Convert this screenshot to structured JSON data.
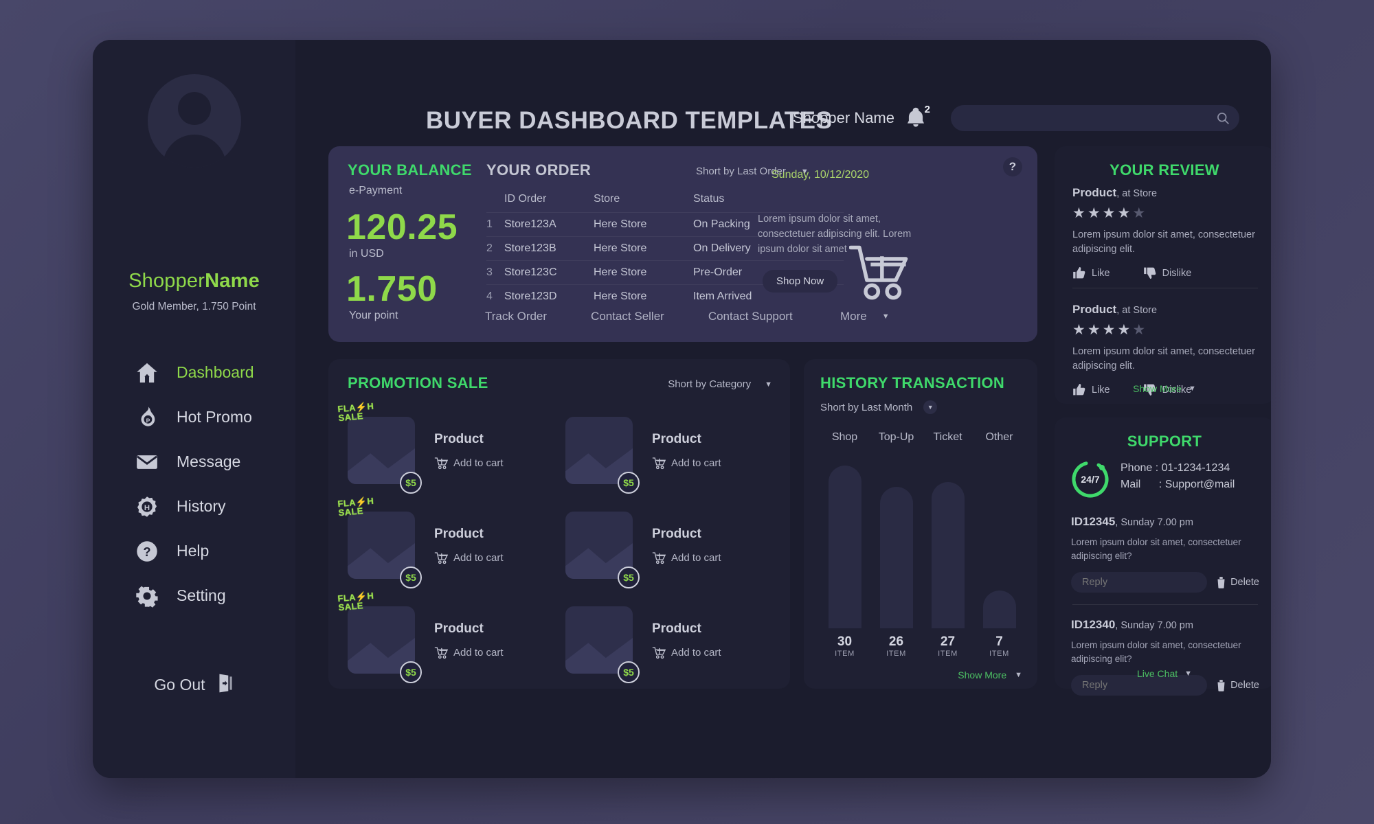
{
  "app": {
    "title": "BUYER DASHBOARD TEMPLATES"
  },
  "header": {
    "shopper_name": "Shopper Name",
    "notification_count": "2",
    "search_placeholder": ""
  },
  "sidebar": {
    "profile": {
      "name_light": "Shopper",
      "name_bold": "Name",
      "subtitle": "Gold Member, 1.750 Point"
    },
    "items": [
      {
        "label": "Dashboard",
        "icon": "home-icon",
        "active": true
      },
      {
        "label": "Hot Promo",
        "icon": "flame-icon",
        "active": false
      },
      {
        "label": "Message",
        "icon": "envelope-icon",
        "active": false
      },
      {
        "label": "History",
        "icon": "history-icon",
        "active": false
      },
      {
        "label": "Help",
        "icon": "question-icon",
        "active": false
      },
      {
        "label": "Setting",
        "icon": "gear-icon",
        "active": false
      }
    ],
    "logout_label": "Go Out"
  },
  "balance": {
    "title": "YOUR BALANCE",
    "epayment_label": "e-Payment",
    "amount": "120.25",
    "currency_label": "in USD",
    "points": "1.750",
    "points_label": "Your point"
  },
  "order": {
    "title": "YOUR ORDER",
    "sort_label": "Short by Last Order",
    "columns": [
      "",
      "ID Order",
      "Store",
      "Status"
    ],
    "rows": [
      {
        "n": "1",
        "id": "Store123A",
        "store": "Here Store",
        "status": "On Packing"
      },
      {
        "n": "2",
        "id": "Store123B",
        "store": "Here Store",
        "status": "On Delivery"
      },
      {
        "n": "3",
        "id": "Store123C",
        "store": "Here Store",
        "status": "Pre-Order"
      },
      {
        "n": "4",
        "id": "Store123D",
        "store": "Here Store",
        "status": "Item Arrived"
      }
    ],
    "links": [
      "Track Order",
      "Contact Seller",
      "Contact Support"
    ],
    "more_label": "More"
  },
  "promo_banner": {
    "help_label": "?",
    "date": "Sunday, 10/12/2020",
    "text": "Lorem ipsum dolor sit amet, consectetuer adipiscing elit. Lorem ipsum dolor sit  amet",
    "shop_now_label": "Shop Now"
  },
  "promotion": {
    "title": "PROMOTION SALE",
    "sort_label": "Short by Category",
    "items": [
      {
        "badge": "FLASH SALE",
        "name": "Product",
        "price": "$5",
        "cart_label": "Add to cart",
        "flash": true
      },
      {
        "badge": "",
        "name": "Product",
        "price": "$5",
        "cart_label": "Add to cart",
        "flash": false
      },
      {
        "badge": "FLASH SALE",
        "name": "Product",
        "price": "$5",
        "cart_label": "Add to cart",
        "flash": true
      },
      {
        "badge": "",
        "name": "Product",
        "price": "$5",
        "cart_label": "Add to cart",
        "flash": false
      },
      {
        "badge": "FLASH SALE",
        "name": "Product",
        "price": "$5",
        "cart_label": "Add to cart",
        "flash": true
      },
      {
        "badge": "",
        "name": "Product",
        "price": "$5",
        "cart_label": "Add to cart",
        "flash": false
      }
    ]
  },
  "history": {
    "title": "HISTORY TRANSACTION",
    "sort_label": "Short by Last Month",
    "show_more_label": "Show More"
  },
  "chart_data": {
    "type": "bar",
    "title": "HISTORY TRANSACTION",
    "categories": [
      "Shop",
      "Top-Up",
      "Ticket",
      "Other"
    ],
    "values": [
      30,
      26,
      27,
      7
    ],
    "value_suffix": "ITEM",
    "xlabel": "",
    "ylabel": "",
    "ylim": [
      0,
      32
    ],
    "grid": false,
    "legend": "none",
    "bar_color": "#2a2b44"
  },
  "review": {
    "title": "YOUR REVIEW",
    "entries": [
      {
        "product": "Product",
        "at_store": ", at Store",
        "rating": 4,
        "max_rating": 5,
        "text": "Lorem ipsum dolor sit amet, consectetuer adipiscing elit.",
        "like_label": "Like",
        "dislike_label": "Dislike"
      },
      {
        "product": "Product",
        "at_store": ", at Store",
        "rating": 4,
        "max_rating": 5,
        "text": "Lorem ipsum dolor sit amet, consectetuer adipiscing elit.",
        "like_label": "Like",
        "dislike_label": "Dislike"
      }
    ],
    "show_more_label": "Show More"
  },
  "support": {
    "title": "SUPPORT",
    "badge": "24/7",
    "phone_label": "Phone",
    "phone_value": ": 01-1234-1234",
    "mail_label": "Mail",
    "mail_value": ": Support@mail",
    "tickets": [
      {
        "id": "ID12345",
        "time": ", Sunday 7.00 pm",
        "text": "Lorem ipsum dolor sit amet, consectetuer adipiscing elit?",
        "reply_placeholder": "Reply",
        "delete_label": "Delete"
      },
      {
        "id": "ID12340",
        "time": ", Sunday 7.00 pm",
        "text": "Lorem ipsum dolor sit amet, consectetuer adipiscing elit?",
        "reply_placeholder": "Reply",
        "delete_label": "Delete"
      }
    ],
    "live_chat_label": "Live Chat"
  },
  "colors": {
    "accent_green": "#3fd96b",
    "accent_lime": "#8fd94a",
    "panel_dark": "#1d1e30",
    "panel_purple": "#343253",
    "app_bg": "#1b1c2d"
  }
}
